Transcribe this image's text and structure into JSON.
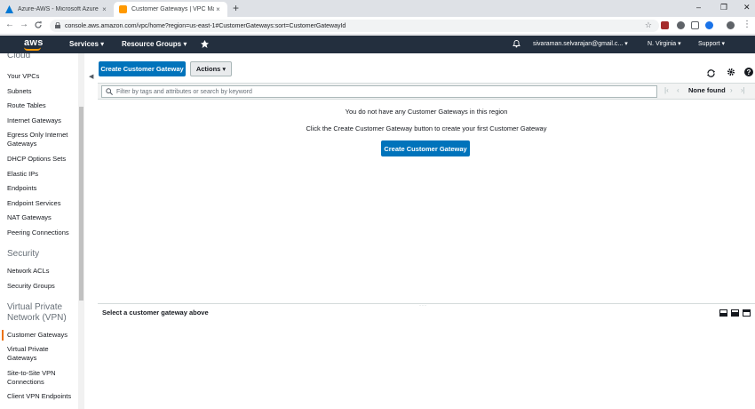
{
  "browser": {
    "tabs": [
      {
        "title": "Azure-AWS - Microsoft Azure",
        "close": "×"
      },
      {
        "title": "Customer Gateways | VPC Management Console",
        "close": "×"
      }
    ],
    "new_tab": "+",
    "window_controls": {
      "minimize": "–",
      "restore": "❐",
      "close": "✕"
    },
    "url": "console.aws.amazon.com/vpc/home?region=us-east-1#CustomerGateways:sort=CustomerGatewayId",
    "nav": {
      "back": "←",
      "forward": "→",
      "reload": "C"
    }
  },
  "aws_nav": {
    "logo": "aws",
    "services": "Services",
    "resource_groups": "Resource Groups",
    "user": "sivaraman.selvarajan@gmail.c...",
    "region": "N. Virginia",
    "support": "Support"
  },
  "sidebar": {
    "partial_heading": "Cloud",
    "vpc_items": [
      "Your VPCs",
      "Subnets",
      "Route Tables",
      "Internet Gateways",
      "Egress Only Internet Gateways",
      "DHCP Options Sets",
      "Elastic IPs",
      "Endpoints",
      "Endpoint Services",
      "NAT Gateways",
      "Peering Connections"
    ],
    "security_heading": "Security",
    "security_items": [
      "Network ACLs",
      "Security Groups"
    ],
    "vpn_heading": "Virtual Private Network (VPN)",
    "vpn_items": [
      "Customer Gateways",
      "Virtual Private Gateways",
      "Site-to-Site VPN Connections",
      "Client VPN Endpoints"
    ],
    "active_item": "Customer Gateways"
  },
  "toolbar": {
    "create_button": "Create Customer Gateway",
    "actions_button": "Actions"
  },
  "filter": {
    "placeholder": "Filter by tags and attributes or search by keyword",
    "pagination": "None found"
  },
  "empty_state": {
    "line1": "You do not have any Customer Gateways in this region",
    "line2": "Click the Create Customer Gateway button to create your first Customer Gateway",
    "button": "Create Customer Gateway"
  },
  "detail_pane": {
    "title": "Select a customer gateway above"
  },
  "colors": {
    "aws_nav_bg": "#232f3e",
    "primary_button": "#0073bb",
    "accent_orange": "#ec7211"
  }
}
